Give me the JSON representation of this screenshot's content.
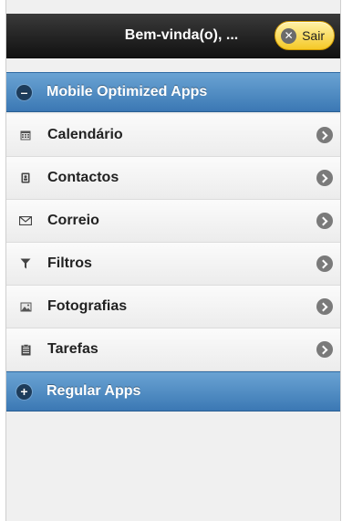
{
  "header": {
    "title": "Bem-vinda(o), ...",
    "logout_label": "Sair",
    "logout_icon": "close-circle-icon"
  },
  "sections": {
    "mobile": {
      "label": "Mobile Optimized Apps",
      "icon": "minus-circle-icon"
    },
    "regular": {
      "label": "Regular Apps",
      "icon": "plus-circle-icon"
    }
  },
  "items": [
    {
      "label": "Calendário",
      "icon": "calendar-icon"
    },
    {
      "label": "Contactos",
      "icon": "address-book-icon"
    },
    {
      "label": "Correio",
      "icon": "envelope-icon"
    },
    {
      "label": "Filtros",
      "icon": "filter-icon"
    },
    {
      "label": "Fotografias",
      "icon": "image-icon"
    },
    {
      "label": "Tarefas",
      "icon": "clipboard-icon"
    }
  ],
  "colors": {
    "header_dark": "#111111",
    "section_blue": "#3b78b4",
    "logout_yellow": "#f5c927"
  }
}
